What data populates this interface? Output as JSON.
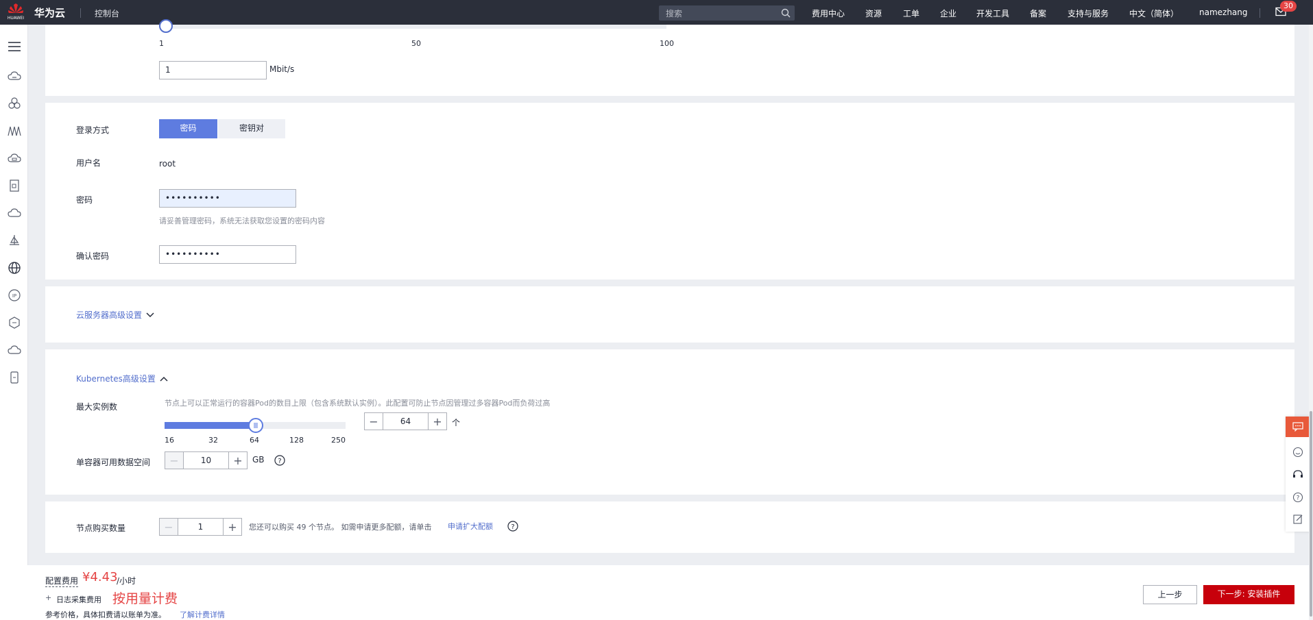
{
  "topbar": {
    "brand": "华为云",
    "console": "控制台",
    "search_placeholder": "搜索",
    "nav": [
      "费用中心",
      "资源",
      "工单",
      "企业",
      "开发工具",
      "备案",
      "支持与服务",
      "中文（简体）",
      "namezhang"
    ],
    "mail_badge": "30",
    "logo_text": "HUAWEI"
  },
  "bandwidth": {
    "ticks": [
      "1",
      "50",
      "100"
    ],
    "value": "1",
    "unit": "Mbit/s"
  },
  "login": {
    "method_label": "登录方式",
    "methods": [
      "密码",
      "密钥对"
    ],
    "selected_method": 0,
    "username_label": "用户名",
    "username": "root",
    "password_label": "密码",
    "password_value": "••••••••••",
    "password_hint": "请妥善管理密码，系统无法获取您设置的密码内容",
    "confirm_label": "确认密码",
    "confirm_value": "••••••••••"
  },
  "advanced_server": {
    "label": "云服务器高级设置"
  },
  "kubernetes": {
    "label": "Kubernetes高级设置",
    "max_instances_label": "最大实例数",
    "max_instances_hint": "节点上可以正常运行的容器Pod的数目上限（包含系统默认实例）。此配置可防止节点因管理过多容器Pod而负荷过高",
    "slider_ticks": [
      "16",
      "32",
      "64",
      "128",
      "250"
    ],
    "slider_value_index": 2,
    "max_instances_value": "64",
    "max_instances_unit": "个",
    "data_space_label": "单容器可用数据空间",
    "data_space_value": "10",
    "data_space_unit": "GB"
  },
  "purchase": {
    "label": "节点购买数量",
    "value": "1",
    "hint": "您还可以购买 49 个节点。 如需申请更多配额，请单击",
    "link": "申请扩大配额"
  },
  "footer": {
    "config_fee_label": "配置费用",
    "price": "¥4.43",
    "price_unit": "/小时",
    "log_fee_label": "日志采集费用",
    "log_fee_value": "按用量计费",
    "note": "参考价格，具体扣费请以账单为准。",
    "note_link": "了解计费详情",
    "prev_button": "上一步",
    "next_button": "下一步: 安装插件"
  },
  "colors": {
    "accent": "#526ecc",
    "danger": "#c7000b",
    "price": "#e54545",
    "topbar": "#2b2f3a"
  }
}
